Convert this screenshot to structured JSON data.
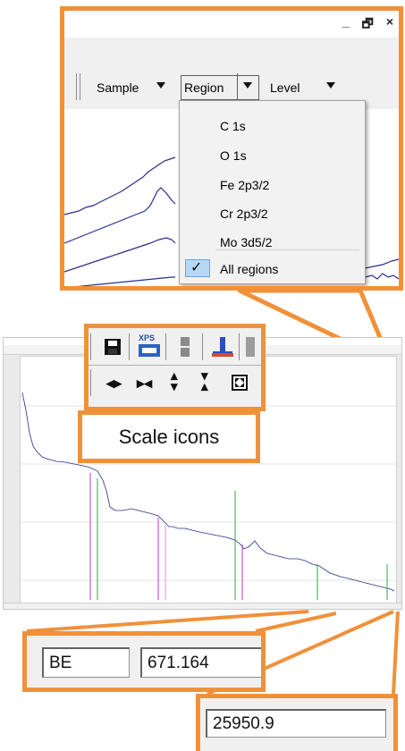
{
  "colors": {
    "callout_border": "#f0913a",
    "spectrum": "#2b2e8c"
  },
  "toolbar": {
    "sample_label": "Sample",
    "region_label": "Region",
    "level_label": "Level"
  },
  "region_menu": {
    "items": [
      "C 1s",
      "O 1s",
      "Fe 2p3/2",
      "Cr 2p3/2",
      "Mo 3d5/2"
    ],
    "all_label": "All regions",
    "all_checked": true
  },
  "window_controls": {
    "minimize": "_",
    "restore": "🗗",
    "close": "×"
  },
  "icons_callout": {
    "top_icons": [
      "save-icon",
      "xps-icon",
      "separator-icon",
      "marker-icon",
      "peak-icon"
    ],
    "scale_icons": [
      "scale-horizontal-expand-icon",
      "scale-horizontal-contract-icon",
      "scale-vertical-expand-icon",
      "scale-vertical-contract-icon",
      "scale-fit-icon"
    ],
    "xps_text": "XPS"
  },
  "scale_label": "Scale icons",
  "be_field": {
    "label": "BE",
    "value": "671.164"
  },
  "value_field": {
    "value": "25950.9"
  }
}
